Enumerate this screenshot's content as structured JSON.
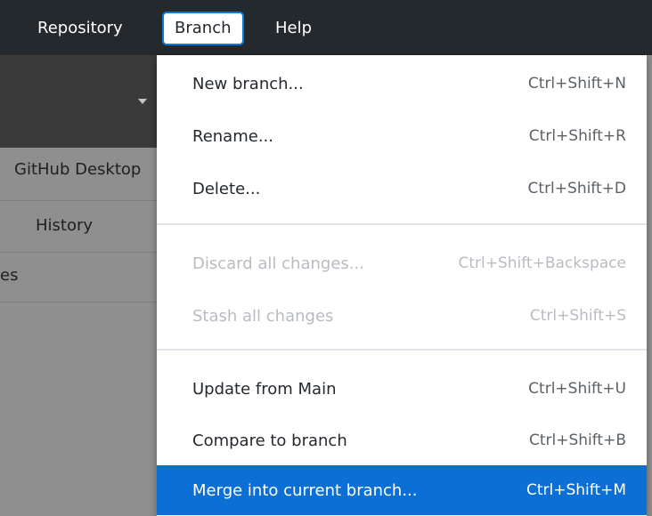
{
  "menubar": {
    "repository": "Repository",
    "branch": "Branch",
    "help": "Help"
  },
  "background": {
    "repo_name": "GitHub Desktop",
    "history_tab": "History",
    "changes_tab_partial": "es"
  },
  "dropdown": {
    "items": [
      {
        "label": "New branch...",
        "shortcut": "Ctrl+Shift+N",
        "enabled": true
      },
      {
        "label": "Rename...",
        "shortcut": "Ctrl+Shift+R",
        "enabled": true
      },
      {
        "label": "Delete...",
        "shortcut": "Ctrl+Shift+D",
        "enabled": true
      },
      {
        "label": "Discard all changes...",
        "shortcut": "Ctrl+Shift+Backspace",
        "enabled": false
      },
      {
        "label": "Stash all changes",
        "shortcut": "Ctrl+Shift+S",
        "enabled": false
      },
      {
        "label": "Update from Main",
        "shortcut": "Ctrl+Shift+U",
        "enabled": true
      },
      {
        "label": "Compare to branch",
        "shortcut": "Ctrl+Shift+B",
        "enabled": true
      },
      {
        "label": "Merge into current branch...",
        "shortcut": "Ctrl+Shift+M",
        "enabled": true,
        "highlighted": true
      }
    ]
  },
  "colors": {
    "menubar_bg": "#24292e",
    "highlight": "#0c6fd6",
    "focus_border": "#0b7bd8"
  }
}
